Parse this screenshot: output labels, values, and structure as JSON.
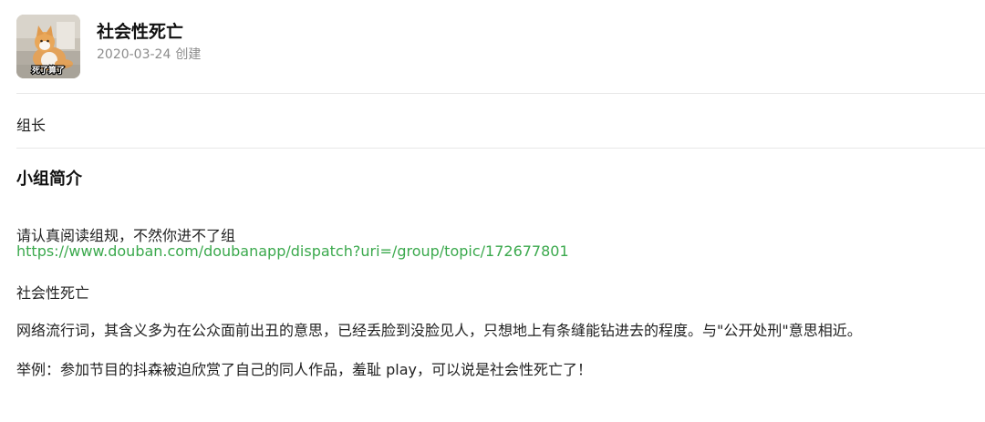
{
  "group": {
    "name": "社会性死亡",
    "created_date": "2020-03-24",
    "created_label": "创建",
    "avatar_caption": "死了算了"
  },
  "role": "组长",
  "intro": {
    "title": "小组简介",
    "rule_line": "请认真阅读组规，不然你进不了组",
    "rule_link": "https://www.douban.com/doubanapp/dispatch?uri=/group/topic/172677801",
    "term": "社会性死亡",
    "definition": "网络流行词，其含义多为在公众面前出丑的意思，已经丢脸到没脸见人，只想地上有条缝能钻进去的程度。与\"公开处刑\"意思相近。",
    "example": "举例：参加节目的抖森被迫欣赏了自己的同人作品，羞耻 play，可以说是社会性死亡了！"
  },
  "colors": {
    "link": "#3ba94d",
    "divider": "#e8e8e8",
    "muted": "#8c8c8c"
  }
}
